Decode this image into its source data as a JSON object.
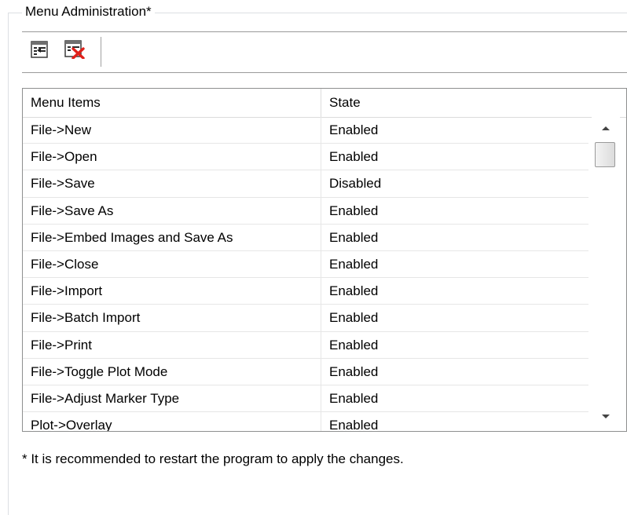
{
  "group": {
    "title": "Menu Administration*"
  },
  "toolbar": {
    "buttons": [
      {
        "icon": "import-menu-icon"
      },
      {
        "icon": "delete-menu-icon"
      }
    ]
  },
  "grid": {
    "columns": [
      "Menu Items",
      "State"
    ],
    "rows": [
      {
        "item": "File->New",
        "state": "Enabled"
      },
      {
        "item": "File->Open",
        "state": "Enabled"
      },
      {
        "item": "File->Save",
        "state": "Disabled"
      },
      {
        "item": "File->Save As",
        "state": "Enabled"
      },
      {
        "item": "File->Embed Images and Save As",
        "state": "Enabled"
      },
      {
        "item": "File->Close",
        "state": "Enabled"
      },
      {
        "item": "File->Import",
        "state": "Enabled"
      },
      {
        "item": "File->Batch Import",
        "state": "Enabled"
      },
      {
        "item": "File->Print",
        "state": "Enabled"
      },
      {
        "item": "File->Toggle Plot Mode",
        "state": "Enabled"
      },
      {
        "item": "File->Adjust Marker Type",
        "state": "Enabled"
      },
      {
        "item": "Plot->Overlay",
        "state": "Enabled"
      }
    ]
  },
  "note": "* It is recommended to restart the program to apply the changes."
}
